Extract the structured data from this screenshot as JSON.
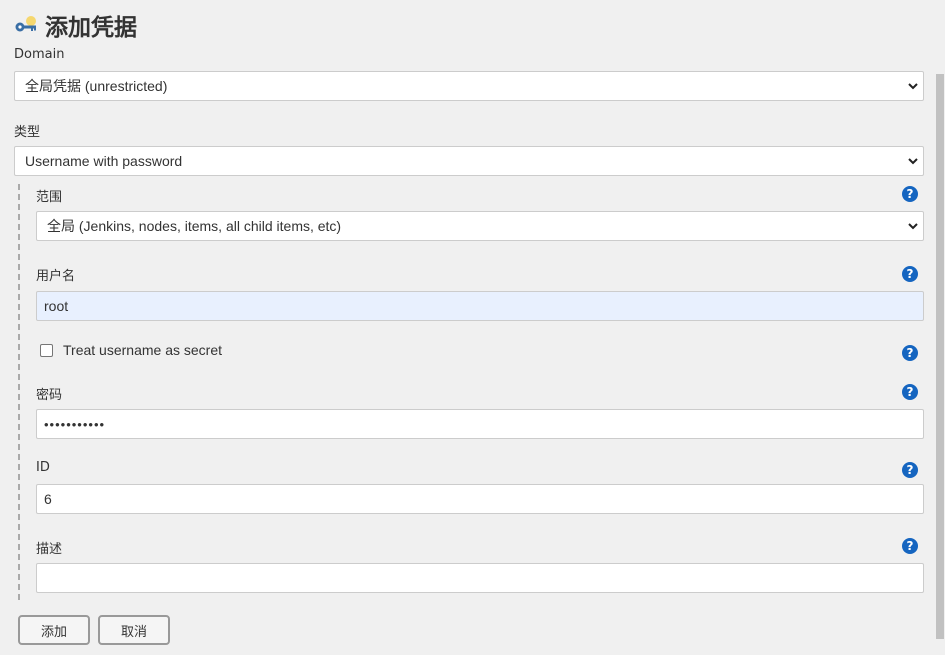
{
  "page": {
    "title": "添加凭据"
  },
  "domain": {
    "label": "Domain",
    "value": "全局凭据 (unrestricted)"
  },
  "kind": {
    "label": "类型",
    "value": "Username with password"
  },
  "scope": {
    "label": "范围",
    "value": "全局 (Jenkins, nodes, items, all child items, etc)"
  },
  "username": {
    "label": "用户名",
    "value": "root"
  },
  "username_secret": {
    "label": "Treat username as secret",
    "checked": false
  },
  "password": {
    "label": "密码",
    "value": "•••••••••••"
  },
  "id": {
    "label": "ID",
    "value": "6"
  },
  "description": {
    "label": "描述",
    "value": ""
  },
  "buttons": {
    "add": "添加",
    "cancel": "取消"
  },
  "help_icon": "?",
  "colors": {
    "help": "#1565c0",
    "autofill": "#e8f0fe"
  },
  "icons": {
    "title": "key-icon",
    "help": "question-circle-icon",
    "select": "chevron-down-icon"
  }
}
